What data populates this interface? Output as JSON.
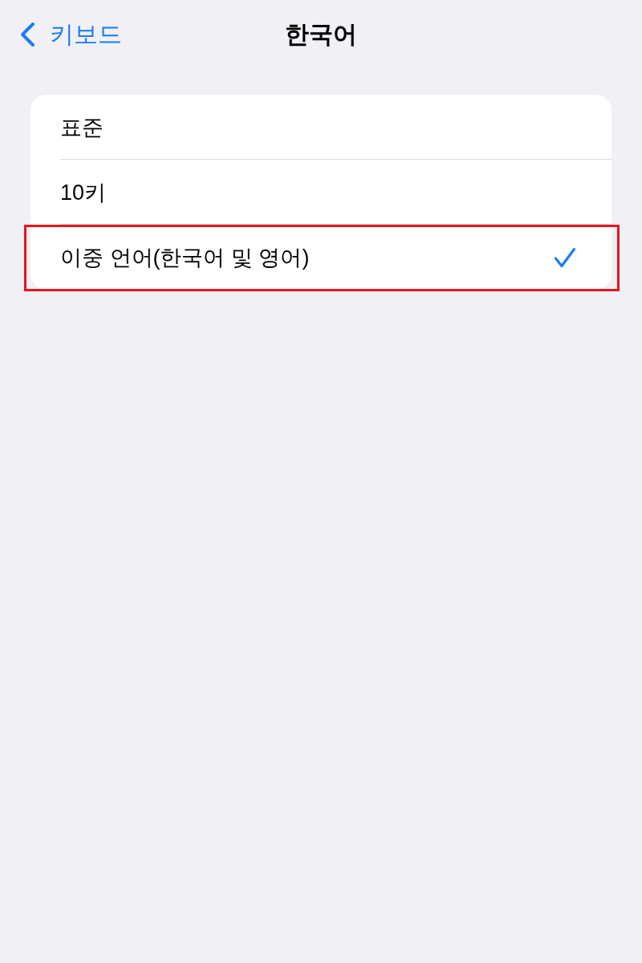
{
  "nav_bar": {
    "back_label": "키보드",
    "title": "한국어"
  },
  "options": [
    {
      "label": "표준",
      "selected": false,
      "highlighted": false
    },
    {
      "label": "10키",
      "selected": false,
      "highlighted": false
    },
    {
      "label": "이중 언어(한국어 및 영어)",
      "selected": true,
      "highlighted": true
    }
  ]
}
